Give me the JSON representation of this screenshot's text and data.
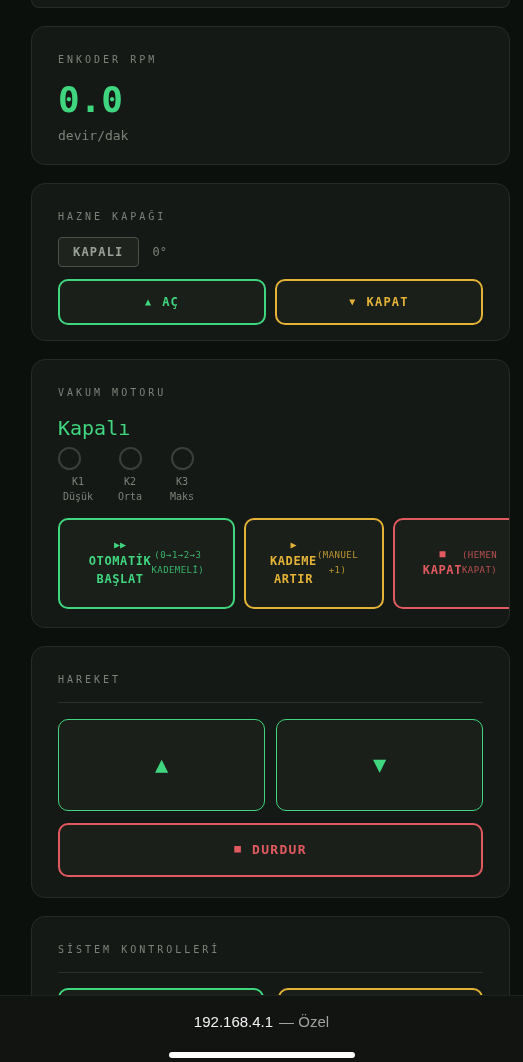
{
  "sections": [
    {
      "kind": "reading",
      "title": "ENKODER RPM",
      "value": "0.0",
      "unit": "devir/dak"
    },
    {
      "kind": "lid",
      "title": "HAZNE KAPAĞI",
      "status": "KAPALI",
      "angle": "0°",
      "buttons": [
        {
          "icon": "▲",
          "label": "AÇ",
          "color": "#3fd67f"
        },
        {
          "icon": "▼",
          "label": "KAPAT",
          "color": "#e3b237"
        }
      ]
    },
    {
      "kind": "motor",
      "title": "VAKUM MOTORU",
      "state": "Kapalı",
      "stages": [
        {
          "code": "K1",
          "name": "Düşük",
          "on": false
        },
        {
          "code": "K2",
          "name": "Orta",
          "on": false
        },
        {
          "code": "K3",
          "name": "Maks",
          "on": false
        }
      ],
      "buttons": [
        {
          "icon": "▶▶",
          "label": "OTOMATİK BAŞLAT",
          "note": "(0→1→2→3 KADEMELİ)",
          "color": "#3fd67f"
        },
        {
          "icon": "▶",
          "label": "KADEME ARTIR",
          "note": "(MANUEL +1)",
          "color": "#e3b237"
        },
        {
          "icon": "■",
          "label": "KAPAT",
          "note": "(HEMEN KAPAT)",
          "color": "#e05a5f"
        }
      ]
    },
    {
      "kind": "motion",
      "title": "HAREKET",
      "buttons": [
        {
          "icon": "▲",
          "color": "#3fd67f"
        },
        {
          "icon": "▼",
          "color": "#3fd67f"
        }
      ],
      "stop": {
        "icon": "■",
        "label": "DURDUR",
        "color": "#e05a5f"
      }
    },
    {
      "kind": "system",
      "title": "SİSTEM KONTROLLERİ",
      "buttons": [
        {
          "color": "#3fd67f"
        },
        {
          "color": "#e3b237"
        }
      ]
    }
  ],
  "address_bar": {
    "address": "192.168.4.1",
    "mode": "— Özel"
  }
}
